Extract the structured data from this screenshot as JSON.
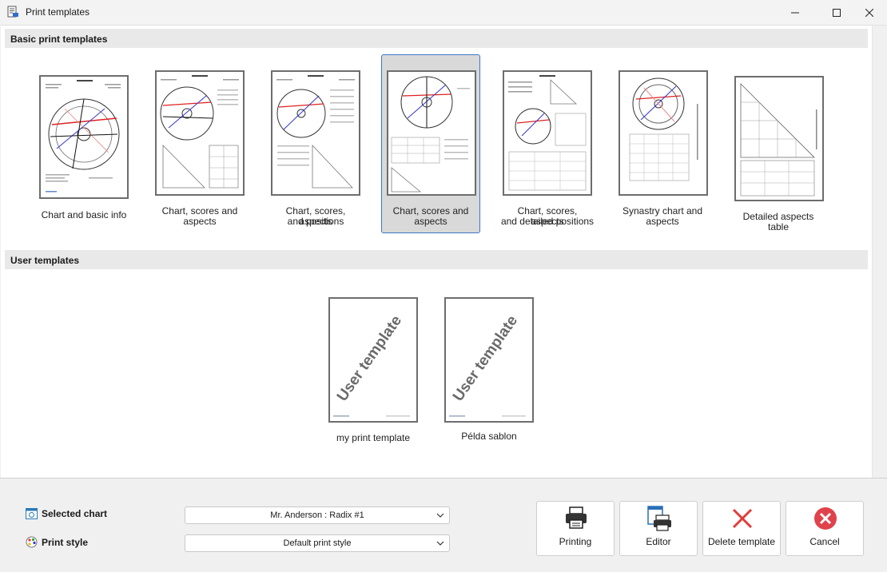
{
  "window": {
    "title": "Print templates"
  },
  "basic_section": {
    "title": "Basic print templates",
    "templates": [
      {
        "line1": "Chart and basic info",
        "line2": ""
      },
      {
        "line1": "Chart, scores and",
        "line2": "aspects"
      },
      {
        "line1": "Chart, scores, aspects",
        "line2": "and positions"
      },
      {
        "line1": "Chart, scores and",
        "line2": "aspects"
      },
      {
        "line1": "Chart, scores, aspects",
        "line2": "and detailed positions"
      },
      {
        "line1": "Synastry chart and",
        "line2": "aspects"
      },
      {
        "line1": "Detailed aspects table",
        "line2": ""
      }
    ]
  },
  "user_section": {
    "title": "User templates",
    "watermark": "User template",
    "templates": [
      {
        "label": "my print template"
      },
      {
        "label": "Példa sablon"
      }
    ]
  },
  "bottom": {
    "selected_chart_label": "Selected chart",
    "selected_chart_value": "Mr. Anderson : Radix #1",
    "print_style_label": "Print style",
    "print_style_value": "Default print style",
    "buttons": {
      "printing": "Printing",
      "editor": "Editor",
      "delete": "Delete template",
      "cancel": "Cancel"
    }
  },
  "colors": {
    "selection_border": "#3b78c6",
    "selection_fill": "#d9d9d9",
    "delete_red": "#e03b3b",
    "cancel_red": "#e0424b"
  }
}
